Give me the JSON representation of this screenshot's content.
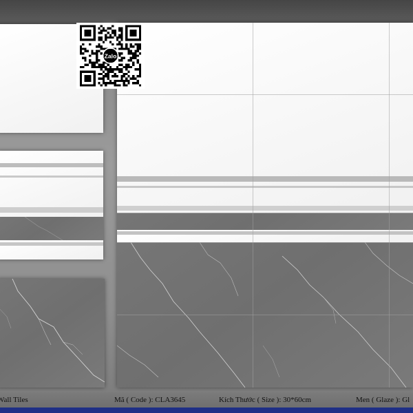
{
  "qr": {
    "badge_label": "Zalo"
  },
  "caption": {
    "product": "Wall Tiles",
    "code": "Mã ( Code ): CLA3645",
    "size": "Kích Thước ( Size ): 30*60cm",
    "glaze": "Men ( Glaze ): Gl"
  },
  "colors": {
    "white_tile": "#f6f6f6",
    "grey_tile": "#727272",
    "stripe_grey": "#b9b9b9",
    "bottom_bar": "#1f2f86"
  }
}
